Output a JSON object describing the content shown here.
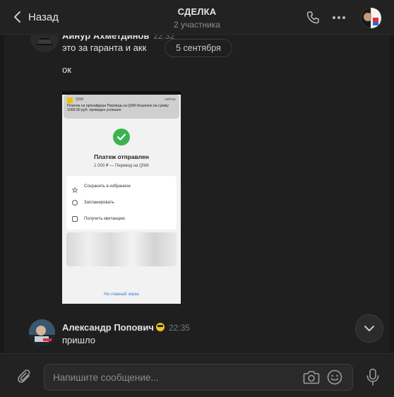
{
  "header": {
    "back_label": "Назад",
    "title": "СДЕЛКА",
    "subtitle": "2 участника"
  },
  "messages": {
    "first": {
      "sender": "Айнур Ахметдинов",
      "time": "22:32",
      "lines": [
        "это за гаранта и акк",
        "ок"
      ]
    },
    "date_separator": "5 сентября",
    "attachment": {
      "notif_app": "QIWI",
      "notif_time": "сейчас",
      "notif_text": "Платеж на прокайдера Перевод на QIWI Кошелек на сумму 1000.00 руб. проведен успешно",
      "title": "Платеж отправлен",
      "subtitle": "1 000 ₽ — Перевод на QIWI",
      "actions": [
        "Сохранить в избранное",
        "Запланировать",
        "Получить квитанцию"
      ],
      "home_link": "На главный экран"
    },
    "second": {
      "sender": "Александр Попович",
      "time": "22:35",
      "text": "пришло"
    }
  },
  "composer": {
    "placeholder": "Напишите сообщение..."
  },
  "colors": {
    "background": "#1f1f1f",
    "header": "#222222",
    "text": "#e1e3e6",
    "muted": "#76787c",
    "success": "#3cb34f"
  }
}
